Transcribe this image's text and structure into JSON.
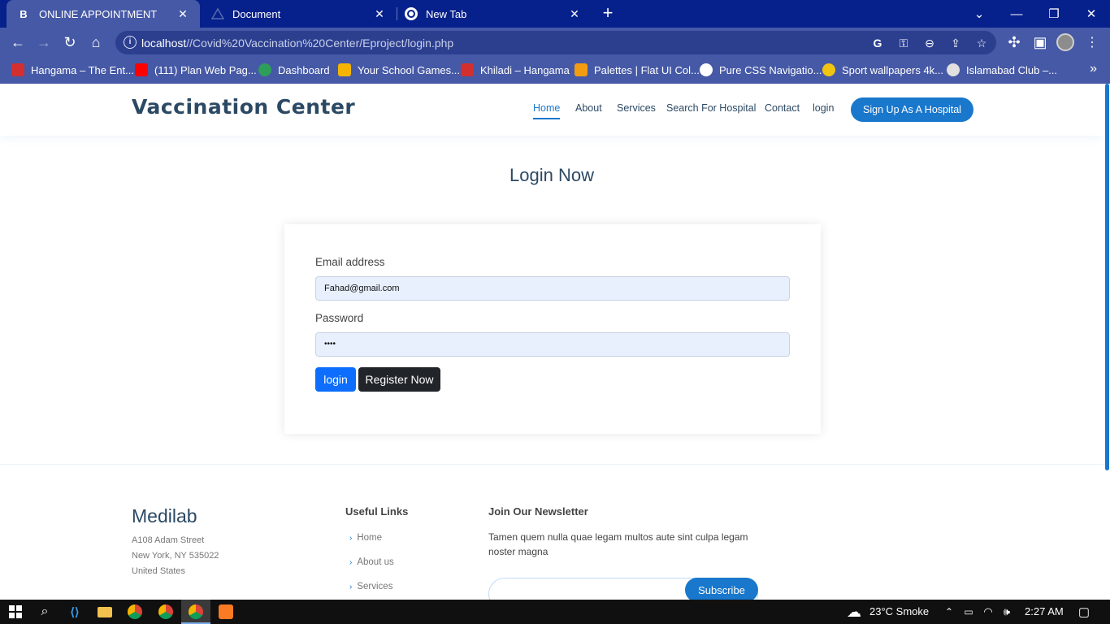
{
  "browser": {
    "tabs": [
      {
        "title": "ONLINE APPOINTMENT",
        "favicon": "b-icon",
        "active": true
      },
      {
        "title": "Document",
        "favicon": "document-icon",
        "active": false
      },
      {
        "title": "New Tab",
        "favicon": "chrome-icon",
        "active": false
      }
    ],
    "address": {
      "host": "localhost",
      "path": "//Covid%20Vaccination%20Center/Eproject/login.php"
    },
    "bookmarks": [
      {
        "label": "Hangama – The Ent...",
        "color": "#d32f2f"
      },
      {
        "label": "(111) Plan Web Pag...",
        "color": "#ff0000"
      },
      {
        "label": "Dashboard",
        "color": "#2e9e5b"
      },
      {
        "label": "Your School Games...",
        "color": "#f4b400"
      },
      {
        "label": "Khiladi – Hangama",
        "color": "#d32f2f"
      },
      {
        "label": "Palettes | Flat UI Col...",
        "color": "#f39c12"
      },
      {
        "label": "Pure CSS Navigatio...",
        "color": "#ffffff"
      },
      {
        "label": "Sport wallpapers 4k...",
        "color": "#f1c40f"
      },
      {
        "label": "Islamabad Club –...",
        "color": "#e0e0e0"
      }
    ],
    "colors": {
      "tabbar": "#06208c",
      "toolbar": "#4659a6"
    }
  },
  "site": {
    "logo": "Vaccination Center",
    "nav": [
      {
        "label": "Home",
        "active": true
      },
      {
        "label": "About",
        "active": false
      },
      {
        "label": "Services",
        "active": false
      },
      {
        "label": "Search For Hospital",
        "active": false
      },
      {
        "label": "Contact",
        "active": false
      },
      {
        "label": "login",
        "active": false
      }
    ],
    "signup_label": "Sign Up As A Hospital",
    "accent": "#1977cc"
  },
  "login": {
    "title": "Login Now",
    "email_label": "Email address",
    "email_value": "Fahad@gmail.com",
    "password_label": "Password",
    "password_value": "••••",
    "login_button": "login",
    "register_button": "Register Now"
  },
  "footer": {
    "brand": "Medilab",
    "address": [
      "A108 Adam Street",
      "New York, NY 535022",
      "United States"
    ],
    "useful_links_title": "Useful Links",
    "useful_links": [
      "Home",
      "About us",
      "Services"
    ],
    "newsletter_title": "Join Our Newsletter",
    "newsletter_text": "Tamen quem nulla quae legam multos aute sint culpa legam noster magna",
    "subscribe_label": "Subscribe"
  },
  "taskbar": {
    "weather": "23°C  Smoke",
    "time": "2:27 AM"
  }
}
